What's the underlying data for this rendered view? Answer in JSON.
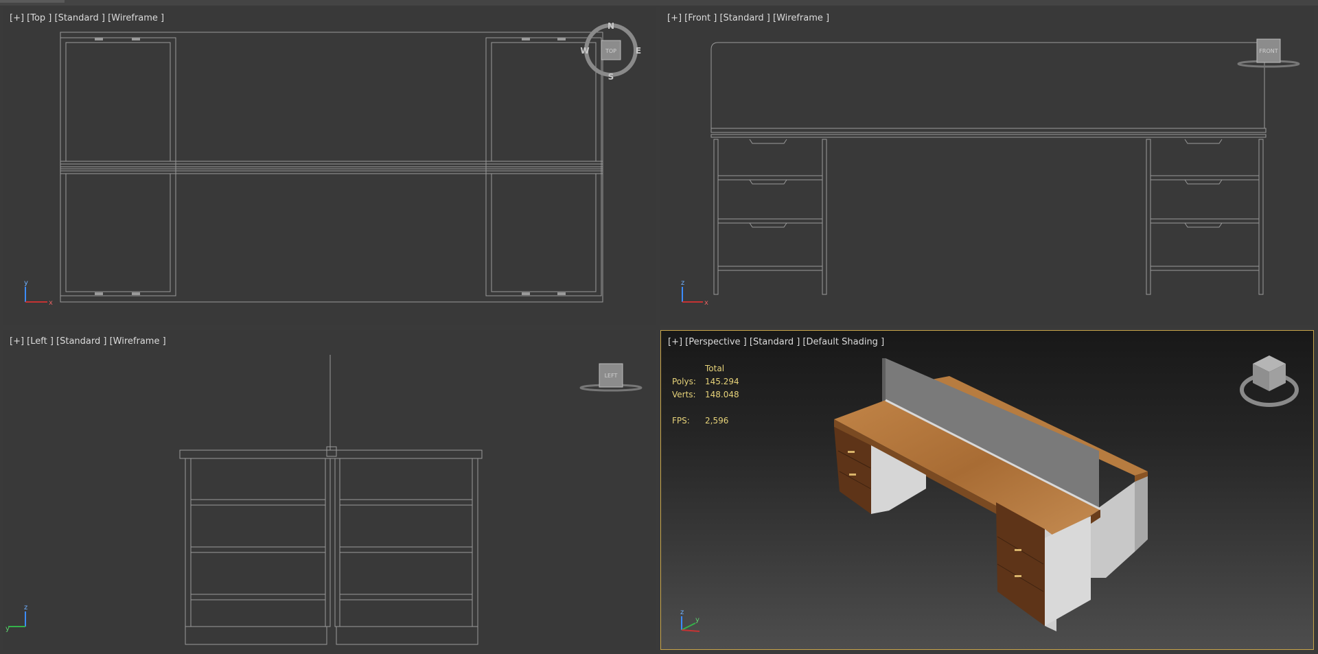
{
  "viewports": {
    "top": {
      "label": "[+] [Top ] [Standard ] [Wireframe ]",
      "compass": {
        "n": "N",
        "s": "S",
        "e": "E",
        "w": "W",
        "cube": "TOP"
      },
      "axes": {
        "a": "y",
        "b": "x"
      }
    },
    "front": {
      "label": "[+] [Front ] [Standard ] [Wireframe ]",
      "cube": "FRONT",
      "axes": {
        "a": "z",
        "b": "x"
      }
    },
    "left": {
      "label": "[+] [Left ] [Standard ] [Wireframe ]",
      "cube": "LEFT",
      "axes": {
        "a": "z",
        "b": "y"
      }
    },
    "perspective": {
      "label": "[+] [Perspective ] [Standard ] [Default Shading ]",
      "stats": {
        "header": "Total",
        "polys_label": "Polys:",
        "polys": "145.294",
        "verts_label": "Verts:",
        "verts": "148.048",
        "fps_label": "FPS:",
        "fps": "2,596"
      },
      "axes": {
        "a": "z",
        "b": "y"
      }
    }
  },
  "colors": {
    "active_border": "#c9a64a",
    "wire": "#9a9a9a",
    "stats_text": "#e7d37a",
    "wood": "#b0743a",
    "drawer": "#6b3a1c",
    "panel": "#7a7a7a"
  }
}
